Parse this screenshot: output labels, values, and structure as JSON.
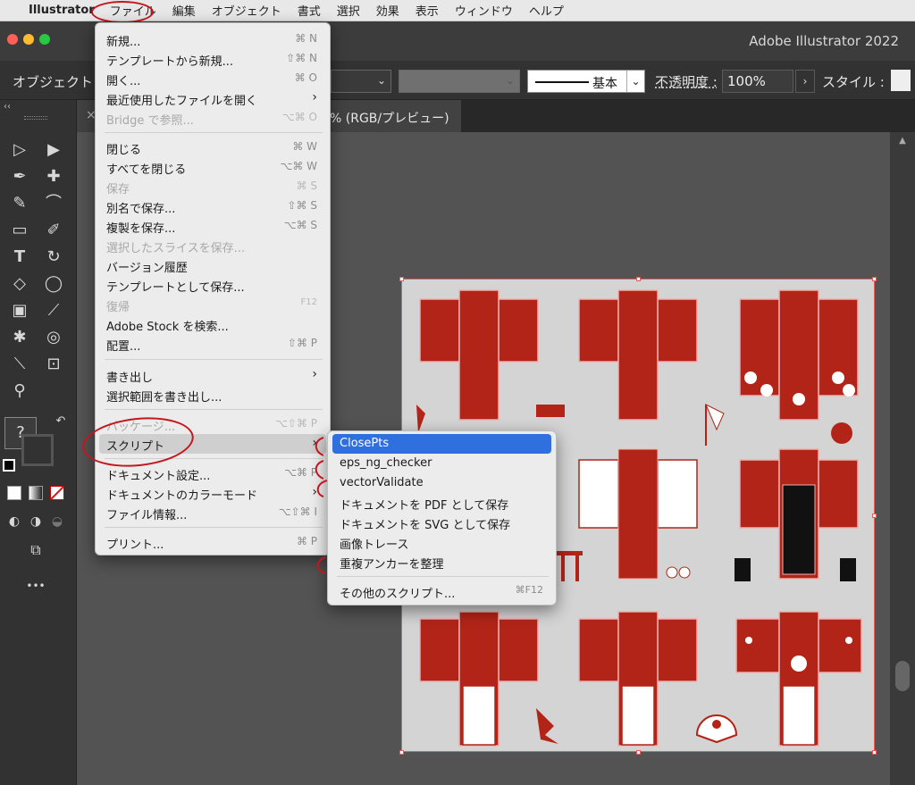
{
  "menubar": {
    "apple": "",
    "app_name": "Illustrator",
    "items": [
      "ファイル",
      "編集",
      "オブジェクト",
      "書式",
      "選択",
      "効果",
      "表示",
      "ウィンドウ",
      "ヘルプ"
    ]
  },
  "window": {
    "title": "Adobe Illustrator 2022"
  },
  "control_bar": {
    "label": "オブジェクト",
    "stroke_profile": "基本",
    "opacity_label": "不透明度 :",
    "opacity_value": "100%",
    "style_label": "スタイル :"
  },
  "document_tab": {
    "title": "% (RGB/プレビュー)",
    "close": "×"
  },
  "file_menu": {
    "items": [
      {
        "label": "新規...",
        "shortcut": "⌘ N",
        "disabled": false
      },
      {
        "label": "テンプレートから新規...",
        "shortcut": "⇧⌘ N",
        "disabled": false
      },
      {
        "label": "開く...",
        "shortcut": "⌘ O",
        "disabled": false
      },
      {
        "label": "最近使用したファイルを開く",
        "shortcut": "›",
        "disabled": false
      },
      {
        "label": "Bridge で参照...",
        "shortcut": "⌥⌘ O",
        "disabled": true
      },
      {
        "label": "閉じる",
        "shortcut": "⌘ W",
        "disabled": false
      },
      {
        "label": "すべてを閉じる",
        "shortcut": "⌥⌘ W",
        "disabled": false
      },
      {
        "label": "保存",
        "shortcut": "⌘ S",
        "disabled": true
      },
      {
        "label": "別名で保存...",
        "shortcut": "⇧⌘ S",
        "disabled": false
      },
      {
        "label": "複製を保存...",
        "shortcut": "⌥⌘ S",
        "disabled": false
      },
      {
        "label": "選択したスライスを保存...",
        "shortcut": "",
        "disabled": true
      },
      {
        "label": "バージョン履歴",
        "shortcut": "",
        "disabled": false
      },
      {
        "label": "テンプレートとして保存...",
        "shortcut": "",
        "disabled": false
      },
      {
        "label": "復帰",
        "shortcut": "F12",
        "disabled": true
      },
      {
        "label": "Adobe Stock を検索...",
        "shortcut": "",
        "disabled": false
      },
      {
        "label": "配置...",
        "shortcut": "⇧⌘ P",
        "disabled": false
      },
      {
        "label": "書き出し",
        "shortcut": "›",
        "disabled": false
      },
      {
        "label": "選択範囲を書き出し...",
        "shortcut": "",
        "disabled": false
      },
      {
        "label": "パッケージ...",
        "shortcut": "⌥⇧⌘ P",
        "disabled": true
      },
      {
        "label": "スクリプト",
        "shortcut": "›",
        "disabled": false
      },
      {
        "label": "ドキュメント設定...",
        "shortcut": "⌥⌘ P",
        "disabled": false
      },
      {
        "label": "ドキュメントのカラーモード",
        "shortcut": "›",
        "disabled": false
      },
      {
        "label": "ファイル情報...",
        "shortcut": "⌥⇧⌘ I",
        "disabled": false
      },
      {
        "label": "プリント...",
        "shortcut": "⌘ P",
        "disabled": false
      }
    ]
  },
  "script_menu": {
    "items": [
      {
        "label": "ClosePts",
        "shortcut": ""
      },
      {
        "label": "eps_ng_checker",
        "shortcut": ""
      },
      {
        "label": "vectorValidate",
        "shortcut": ""
      },
      {
        "label": "ドキュメントを PDF として保存",
        "shortcut": ""
      },
      {
        "label": "ドキュメントを SVG として保存",
        "shortcut": ""
      },
      {
        "label": "画像トレース",
        "shortcut": ""
      },
      {
        "label": "重複アンカーを整理",
        "shortcut": ""
      },
      {
        "label": "その他のスクリプト...",
        "shortcut": "⌘F12"
      }
    ]
  },
  "tool_panel": {
    "header": "‹‹",
    "more": "•••",
    "swatch_unknown": "?"
  },
  "colors": {
    "kimono_red": "#b22418",
    "selection_blue": "#2f6fde",
    "annotation_red": "#c4161c"
  }
}
